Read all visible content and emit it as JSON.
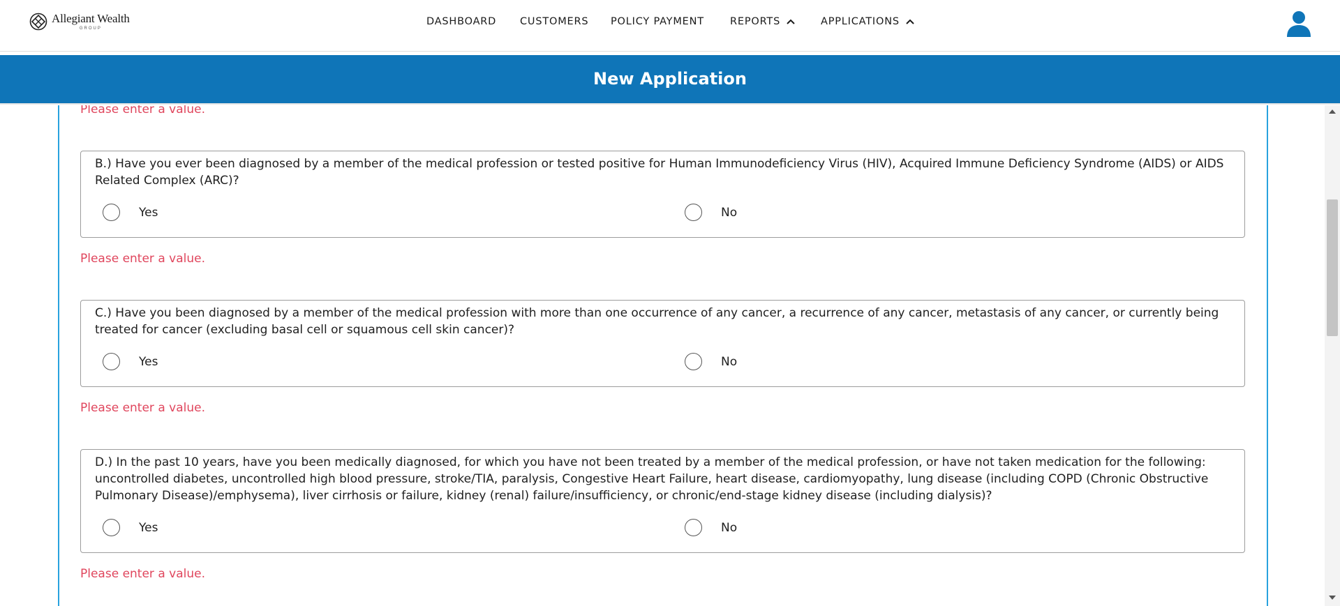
{
  "brand": {
    "name": "Allegiant Wealth",
    "sub": "GROUP",
    "logo_icon": "diamond-emblem-icon"
  },
  "nav": {
    "items": [
      {
        "label": "DASHBOARD"
      },
      {
        "label": "CUSTOMERS"
      },
      {
        "label": "POLICY PAYMENT"
      },
      {
        "label": "REPORTS",
        "icon": "chevron-up-icon"
      },
      {
        "label": "APPLICATIONS",
        "icon": "chevron-up-icon"
      }
    ],
    "user_icon": "user-icon"
  },
  "header": {
    "title": "New Application",
    "color": "#0f75b8"
  },
  "validation": {
    "message": "Please enter a value.",
    "color": "#e0465d"
  },
  "form": {
    "top_error": "Please enter a value.",
    "questions": [
      {
        "text": "B.) Have you ever been diagnosed by a member of the medical profession or tested positive for Human Immunodeficiency Virus (HIV), Acquired Immune Deficiency Syndrome (AIDS) or AIDS Related Complex (ARC)?",
        "options": [
          "Yes",
          "No"
        ],
        "selected": null,
        "error": "Please enter a value."
      },
      {
        "text": "C.) Have you been diagnosed by a member of the medical profession with more than one occurrence of any cancer, a recurrence of any cancer, metastasis of any cancer, or currently being treated for cancer (excluding basal cell or squamous cell skin cancer)?",
        "options": [
          "Yes",
          "No"
        ],
        "selected": null,
        "error": "Please enter a value."
      },
      {
        "text": "D.) In the past 10 years, have you been medically diagnosed, for which you have not been treated by a member of the medical profession, or have not taken medication for the following: uncontrolled diabetes, uncontrolled high blood pressure, stroke/TIA, paralysis, Congestive Heart Failure, heart disease, cardiomyopathy, lung disease (including COPD (Chronic Obstructive Pulmonary Disease)/emphysema), liver cirrhosis or failure, kidney (renal) failure/insufficiency, or chronic/end-stage kidney disease (including dialysis)?",
        "options": [
          "Yes",
          "No"
        ],
        "selected": null,
        "error": "Please enter a value."
      }
    ]
  }
}
